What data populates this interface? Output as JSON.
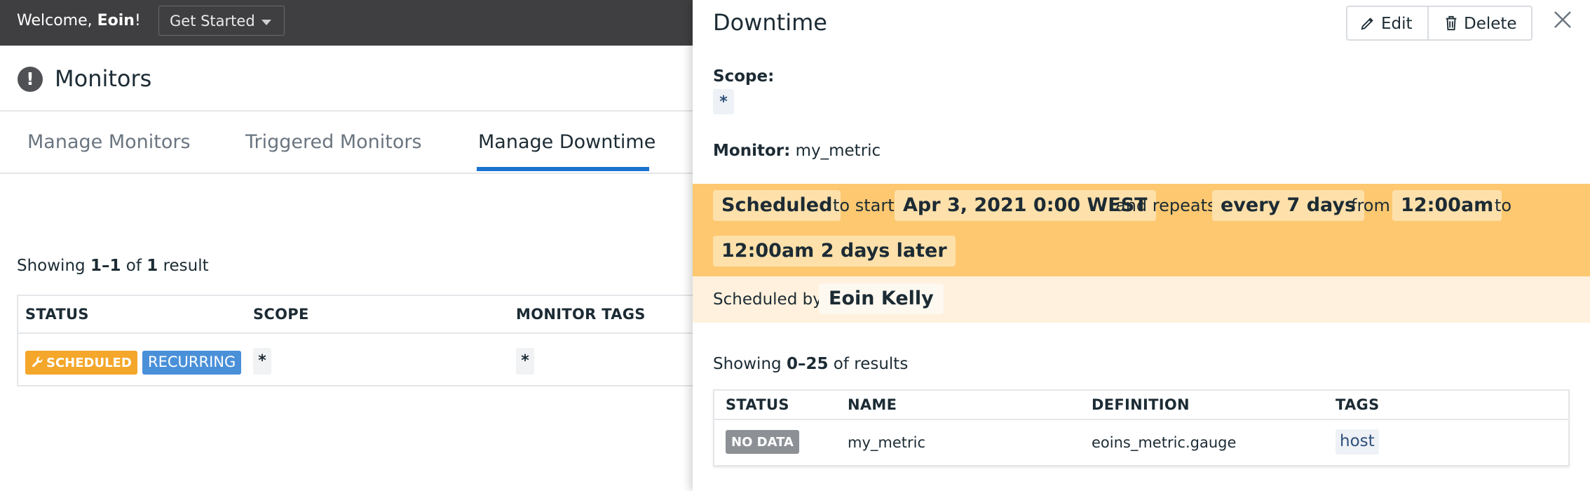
{
  "topbar": {
    "welcome_prefix": "Welcome, ",
    "user_name": "Eoin",
    "welcome_suffix": "!",
    "get_started": "Get Started"
  },
  "page": {
    "title": "Monitors",
    "tabs": [
      {
        "label": "Manage Monitors"
      },
      {
        "label": "Triggered Monitors"
      },
      {
        "label": "Manage Downtime",
        "active": true
      }
    ]
  },
  "list": {
    "showing_prefix": "Showing ",
    "range": "1–1",
    "of": " of ",
    "total": "1",
    "suffix": " result",
    "columns": [
      "STATUS",
      "SCOPE",
      "MONITOR TAGS"
    ],
    "row": {
      "status_badge": "SCHEDULED",
      "recurring_badge": "RECURRING",
      "scope": "*",
      "monitor_tags": "*"
    }
  },
  "drawer": {
    "title": "Downtime",
    "edit_label": "Edit",
    "delete_label": "Delete",
    "scope_label": "Scope:",
    "scope_value": "*",
    "monitor_label": "Monitor:",
    "monitor_value": "my_metric",
    "schedule": {
      "status": "Scheduled",
      "to_start": "to start",
      "start_date": "Apr 3, 2021 0:00 WEST",
      "and_repeats": "and repeats",
      "interval": "every 7 days",
      "from": "from",
      "from_time": "12:00am",
      "to": "to",
      "to_time": "12:00am 2 days later"
    },
    "scheduled_by_label": "Scheduled by",
    "scheduled_by": "Eoin Kelly",
    "results": {
      "showing_prefix": "Showing ",
      "range": "0–25",
      "suffix": " of results",
      "columns": [
        "STATUS",
        "NAME",
        "DEFINITION",
        "TAGS"
      ],
      "row": {
        "status": "NO DATA",
        "name": "my_metric",
        "definition": "eoins_metric.gauge",
        "tag": "host"
      }
    }
  },
  "colors": {
    "accent": "#1a73d1",
    "scheduled_badge": "#f4a72a",
    "recurring_badge": "#4a90d9",
    "schedule_band": "#fdc870",
    "scheduled_by_band": "#fff1dd",
    "no_data_badge": "#8d9095"
  },
  "icons": [
    "exclamation-circle-icon",
    "caret-down-icon",
    "wrench-icon",
    "pencil-icon",
    "trash-icon",
    "close-icon"
  ]
}
